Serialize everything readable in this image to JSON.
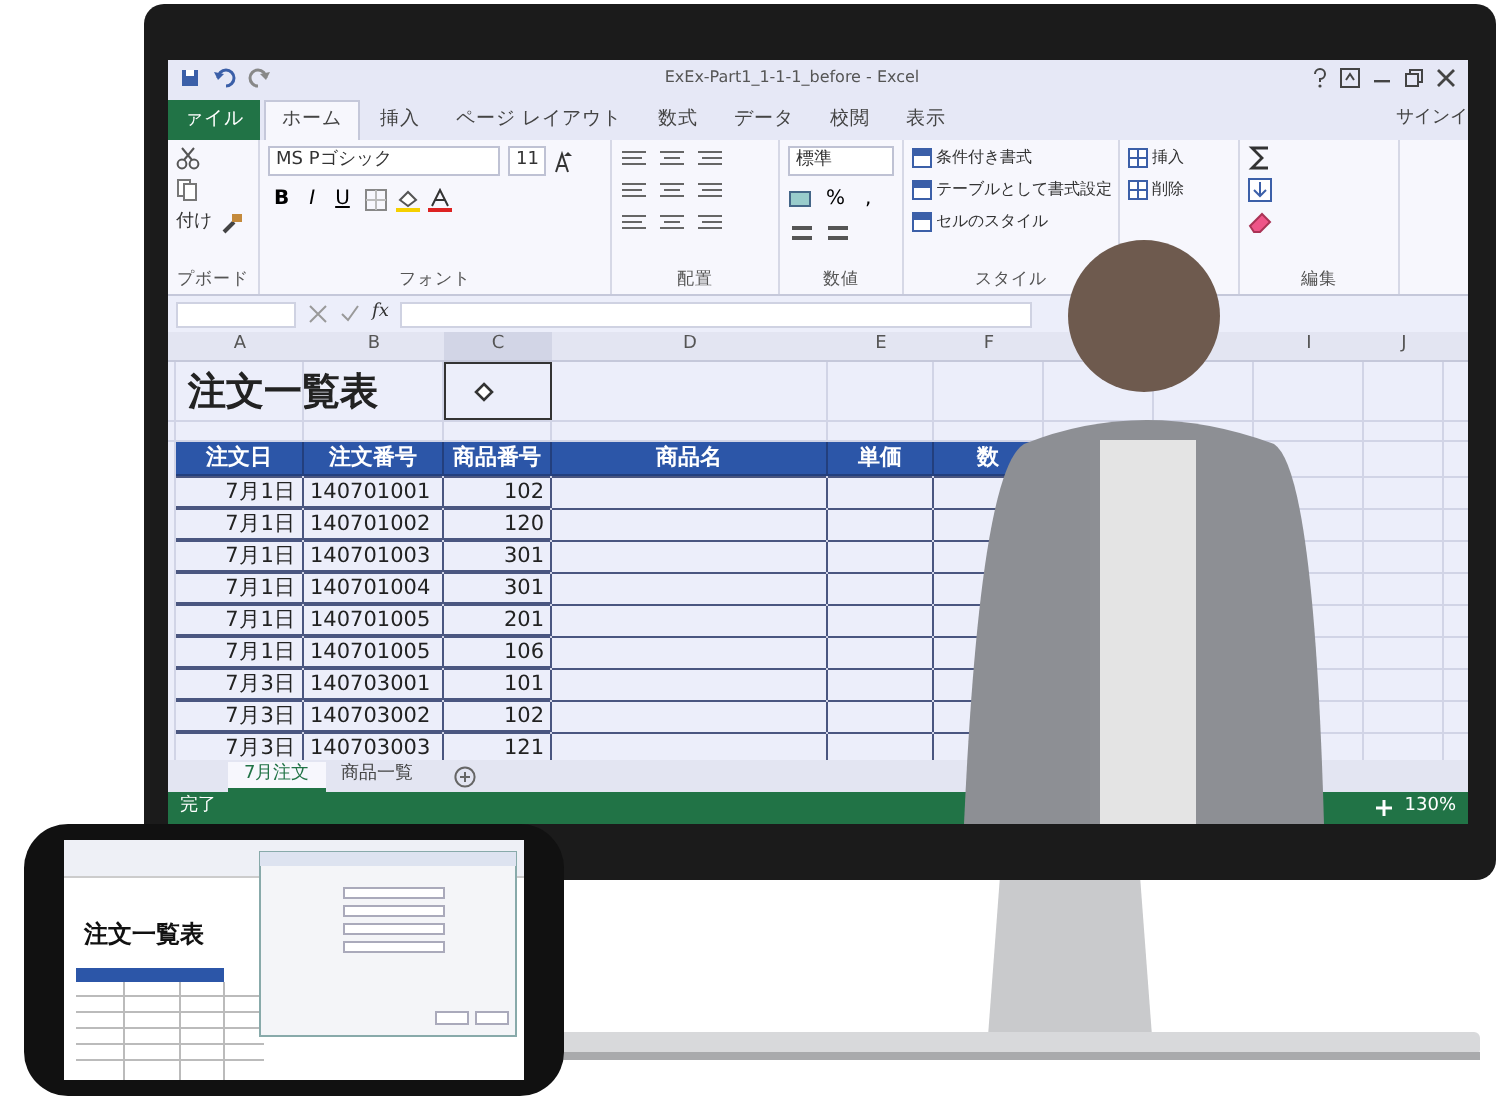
{
  "window": {
    "title": "ExEx-Part1_1-1-1_before - Excel",
    "signin": "サインイ"
  },
  "ribbon_tabs": [
    {
      "label": "ァイル",
      "kind": "file",
      "selected": false
    },
    {
      "label": "ホーム",
      "kind": "tab",
      "selected": true
    },
    {
      "label": "挿入",
      "kind": "tab",
      "selected": false
    },
    {
      "label": "ページ レイアウト",
      "kind": "tab",
      "selected": false
    },
    {
      "label": "数式",
      "kind": "tab",
      "selected": false
    },
    {
      "label": "データ",
      "kind": "tab",
      "selected": false
    },
    {
      "label": "校閲",
      "kind": "tab",
      "selected": false
    },
    {
      "label": "表示",
      "kind": "tab",
      "selected": false
    }
  ],
  "ribbon": {
    "paste_label": "付け",
    "font_name": "MS Pゴシック",
    "font_size": "11",
    "format_buttons": [
      "B",
      "I",
      "U"
    ],
    "number_format": "標準",
    "number_symbols": [
      "%",
      ","
    ],
    "style_commands": [
      "条件付き書式",
      "テーブルとして書式設定",
      "セルのスタイル"
    ],
    "cell_commands": [
      "挿入",
      "削除"
    ],
    "group_labels": [
      "プボード",
      "フォント",
      "配置",
      "数値",
      "スタイル",
      "編集"
    ]
  },
  "formula_bar": {
    "function_label": "fx"
  },
  "sheet": {
    "column_headers": [
      "A",
      "B",
      "C",
      "D",
      "E",
      "F"
    ],
    "right_column_headers": [
      "I",
      "J"
    ],
    "title": "注文一覧表",
    "table_headers": [
      "注文日",
      "注文番号",
      "商品番号",
      "商品名",
      "単価",
      "数"
    ],
    "rows": [
      [
        "7月1日",
        "140701001",
        "102"
      ],
      [
        "7月1日",
        "140701002",
        "120"
      ],
      [
        "7月1日",
        "140701003",
        "301"
      ],
      [
        "7月1日",
        "140701004",
        "301"
      ],
      [
        "7月1日",
        "140701005",
        "201"
      ],
      [
        "7月1日",
        "140701005",
        "106"
      ],
      [
        "7月3日",
        "140703001",
        "101"
      ],
      [
        "7月3日",
        "140703002",
        "102"
      ],
      [
        "7月3日",
        "140703003",
        "121"
      ]
    ]
  },
  "sheet_tabs": [
    {
      "label": "7月注文",
      "selected": true
    },
    {
      "label": "商品一覧",
      "selected": false
    }
  ],
  "status_bar": {
    "status": "完了",
    "zoom": "130%"
  },
  "phone": {
    "sheet_title": "注文一覧表"
  }
}
